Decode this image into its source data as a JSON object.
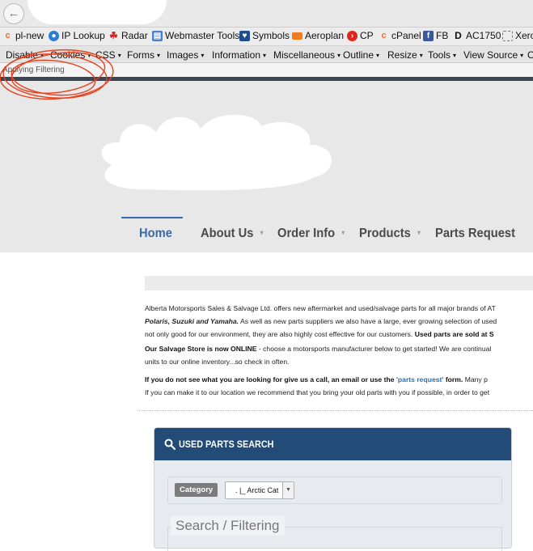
{
  "browser": {
    "back_glyph": "←"
  },
  "bookmarks": [
    {
      "label": "pl-new",
      "icon": "cpanel-icon",
      "color": "#ff6c2c"
    },
    {
      "label": "IP Lookup",
      "icon": "globe-icon",
      "color": "#2f7bd1"
    },
    {
      "label": "Radar",
      "icon": "maple-leaf-icon",
      "color": "#d42020"
    },
    {
      "label": "Webmaster Tools",
      "icon": "webmaster-icon",
      "color": "#4b7fcb"
    },
    {
      "label": "Symbols",
      "icon": "heart-icon",
      "color": "#1f4d8c"
    },
    {
      "label": "Aeroplan",
      "icon": "aeroplan-icon",
      "color": "#f47a20"
    },
    {
      "label": "CP",
      "icon": "cp-icon",
      "color": "#e0261b"
    },
    {
      "label": "cPanel",
      "icon": "cpanel-icon",
      "color": "#ff6c2c"
    },
    {
      "label": "FB",
      "icon": "facebook-icon",
      "color": "#3b5998"
    },
    {
      "label": "AC1750",
      "icon": "router-icon",
      "color": "#111111"
    },
    {
      "label": "Xero",
      "icon": "page-icon",
      "color": "#777777"
    }
  ],
  "devbar": [
    "Disable",
    "Cookies",
    "CSS",
    "Forms",
    "Images",
    "Information",
    "Miscellaneous",
    "Outline",
    "Resize",
    "Tools",
    "View Source",
    "O"
  ],
  "status": "Applying Filtering",
  "nav": {
    "home": "Home",
    "about": "About Us",
    "order": "Order Info",
    "products": "Products",
    "parts": "Parts Request"
  },
  "content": {
    "p1_line1": "Alberta Motorsports Sales & Salvage Ltd. offers new aftermarket and used/salvage parts for all major brands of AT",
    "p1_brands": "Polaris, Suzuki and Yamaha.",
    "p1_line2_rest": "  As well as new parts suppliers we also have a large, ever growing selection of used",
    "p1_line3": "not only good for our environment, they are also highly cost effective for our customers. ",
    "p1_line3_bold": "Used parts are sold at S",
    "p2_bold": "Our Salvage Store is now ONLINE",
    "p2_line1": " - choose a motorsports manufacturer below to get started! We are continual",
    "p2_line2": "units to our online inventory...so check in often.",
    "p3_bold1": "If you do not see what you are looking for give us a call, an email or use the ",
    "p3_link": "'parts request'",
    "p3_bold2": " form.",
    "p3_line1_rest": "  Many p",
    "p3_line2": "If you can make it to our location we recommend that you bring your old parts with you if possible, in order to get"
  },
  "search_panel": {
    "title": "USED PARTS SEARCH",
    "category_label": "Category",
    "category_value": ".   |_ Arctic Cat",
    "filter_legend": "Search / Filtering"
  },
  "colors": {
    "accent": "#3b6aa8",
    "panel_header": "#224b78",
    "annotation": "#e8401c"
  }
}
